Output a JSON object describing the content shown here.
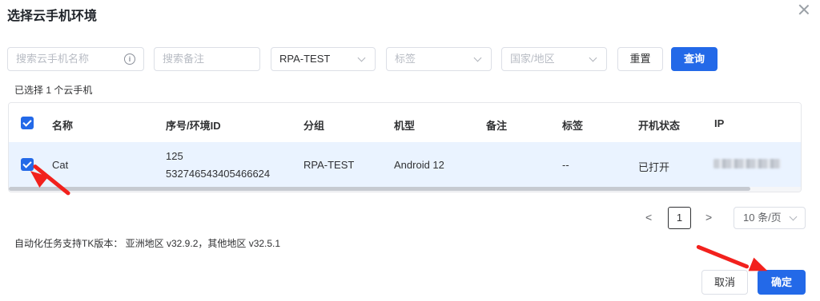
{
  "dialog": {
    "title": "选择云手机环境"
  },
  "filters": {
    "name_placeholder": "搜索云手机名称",
    "remark_placeholder": "搜索备注",
    "group_value": "RPA-TEST",
    "tag_placeholder": "标签",
    "region_placeholder": "国家/地区",
    "reset_label": "重置",
    "query_label": "查询"
  },
  "selection_info": "已选择 1 个云手机",
  "table": {
    "columns": [
      "名称",
      "序号/环境ID",
      "分组",
      "机型",
      "备注",
      "标签",
      "开机状态",
      "IP"
    ],
    "rows": [
      {
        "name": "Cat",
        "seq": "125",
        "env_id": "532746543405466624",
        "group": "RPA-TEST",
        "model": "Android 12",
        "remark": "",
        "tag": "--",
        "status": "已打开",
        "ip": "",
        "selected": true
      }
    ]
  },
  "pagination": {
    "prev": "<",
    "current_page": "1",
    "next": ">",
    "page_size": "10 条/页"
  },
  "footer_note": "自动化任务支持TK版本： 亚洲地区 v32.9.2，其他地区 v32.5.1",
  "buttons": {
    "cancel_label": "取消",
    "confirm_label": "确定"
  },
  "colors": {
    "primary": "#2369e8",
    "annotation_arrow": "#f2211d",
    "selected_row": "#eaf3ff"
  }
}
